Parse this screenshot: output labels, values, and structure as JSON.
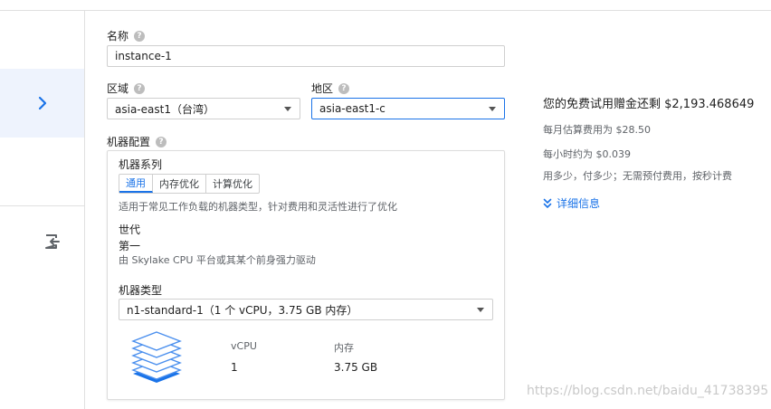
{
  "sidebar": {
    "expand_icon": "chevron-right-icon",
    "exit_icon": "exit-to-app-icon"
  },
  "form": {
    "name_label": "名称",
    "name_value": "instance-1",
    "region_label": "区域",
    "region_value": "asia-east1（台湾）",
    "zone_label": "地区",
    "zone_value": "asia-east1-c",
    "machine_config_label": "机器配置",
    "help_icon": "help-icon"
  },
  "machine": {
    "family_label": "机器系列",
    "tabs": [
      "通用",
      "内存优化",
      "计算优化"
    ],
    "active_tab": 0,
    "family_description": "适用于常见工作负载的机器类型，针对费用和灵活性进行了优化",
    "generation_label": "世代",
    "generation_value": "第一",
    "generation_description": "由 Skylake CPU 平台或其某个前身强力驱动",
    "type_label": "机器类型",
    "type_value": "n1-standard-1（1 个 vCPU，3.75 GB 内存）",
    "specs": {
      "vcpu_label": "vCPU",
      "vcpu_value": "1",
      "memory_label": "内存",
      "memory_value": "3.75 GB"
    }
  },
  "pricing": {
    "free_trial": "您的免费试用赠金还剩 $2,193.468649",
    "monthly": "每月估算费用为 $28.50",
    "hourly": "每小时约为 $0.039",
    "billing_note": "用多少，付多少；无需预付费用，按秒计费",
    "details_link": "详细信息"
  },
  "watermark": "https://blog.csdn.net/baidu_41738395",
  "colors": {
    "accent": "#1a73e8",
    "rail_active": "#eef3fd"
  }
}
